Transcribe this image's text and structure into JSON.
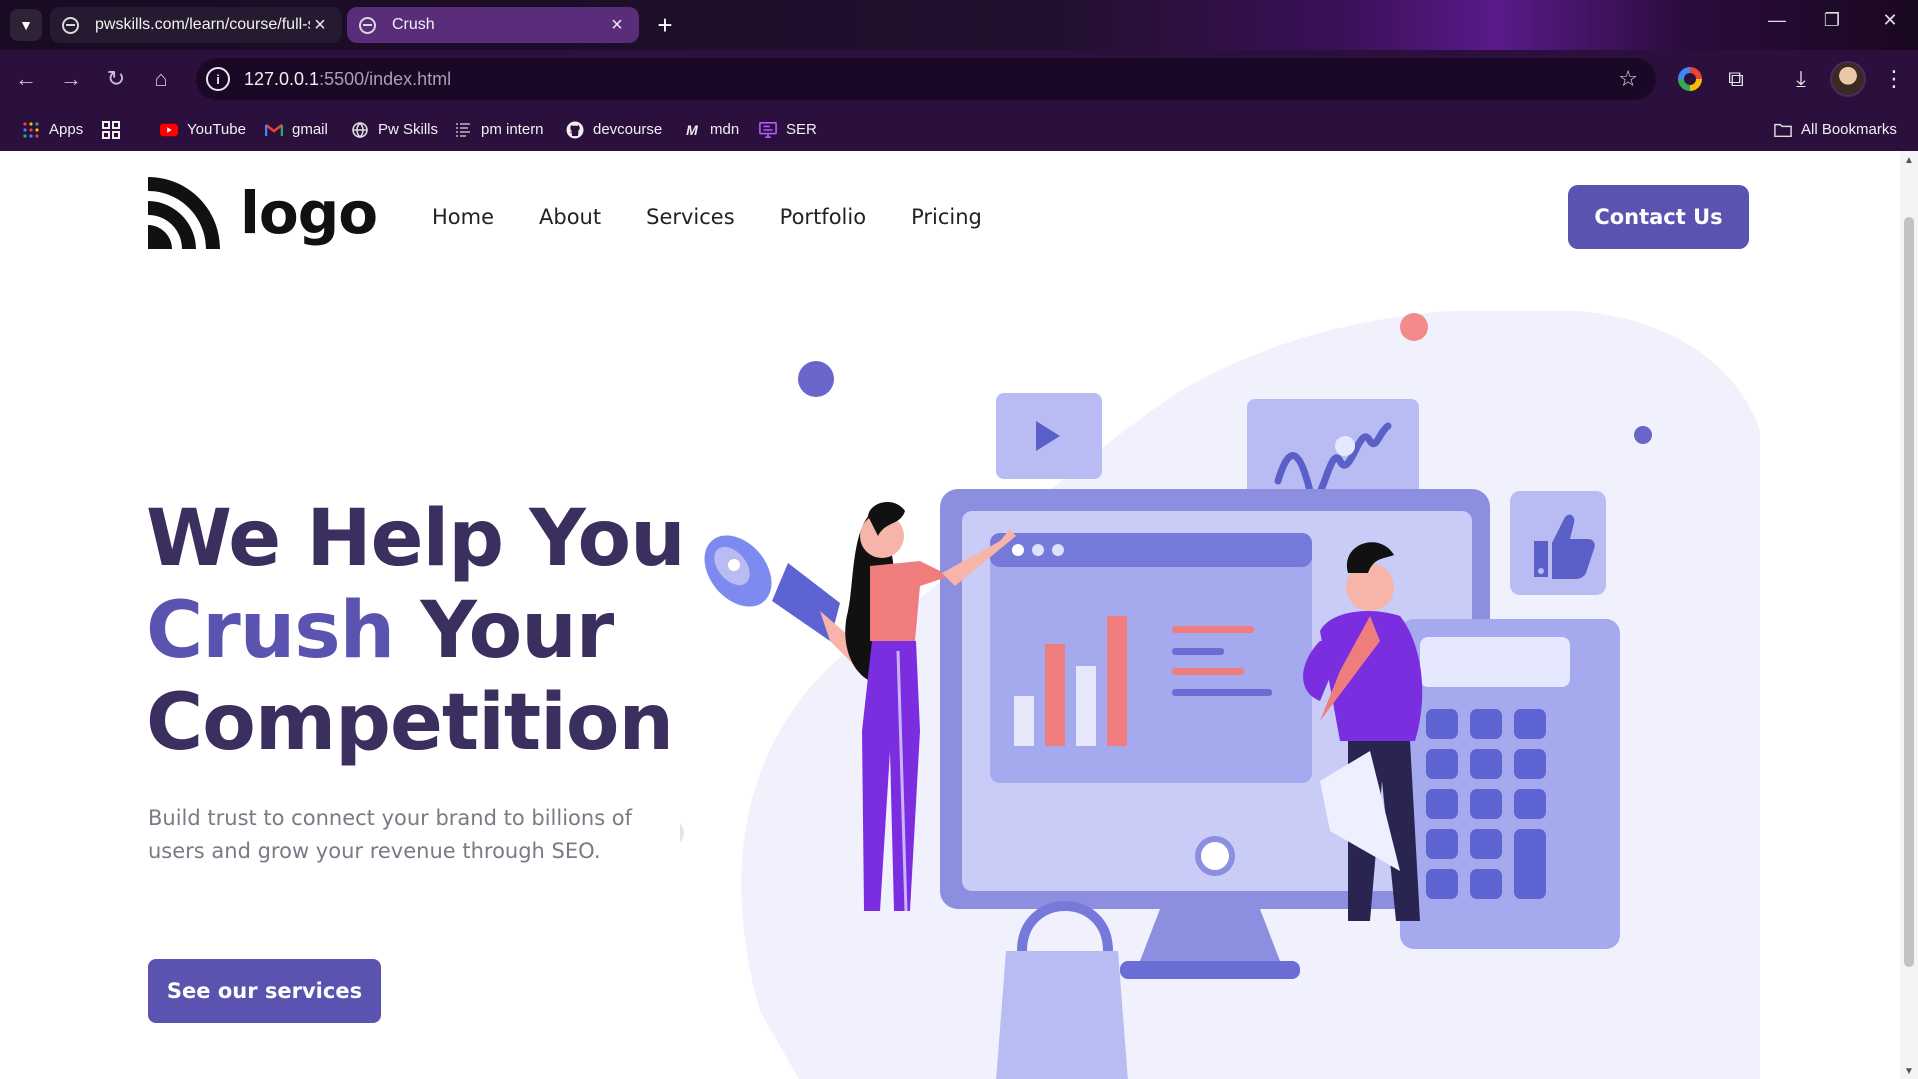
{
  "browser": {
    "tabs": [
      {
        "title": "pwskills.com/learn/course/full-s",
        "active": false
      },
      {
        "title": "Crush",
        "active": true
      }
    ],
    "url": {
      "host": "127.0.0.1",
      "path": ":5500/index.html"
    },
    "bookmarks": [
      {
        "label": "Apps",
        "icon": "apps-grid-icon"
      },
      {
        "label": "",
        "icon": "tab-groups-icon"
      },
      {
        "label": "YouTube",
        "icon": "youtube-icon"
      },
      {
        "label": "gmail",
        "icon": "gmail-icon"
      },
      {
        "label": "Pw Skills",
        "icon": "globe-icon"
      },
      {
        "label": "pm intern",
        "icon": "list-icon"
      },
      {
        "label": "devcourse",
        "icon": "github-icon"
      },
      {
        "label": "mdn",
        "icon": "mdn-icon"
      },
      {
        "label": "SER",
        "icon": "monitor-icon"
      }
    ],
    "all_bookmarks": "All Bookmarks"
  },
  "site": {
    "logo_text": "logo",
    "nav": [
      "Home",
      "About",
      "Services",
      "Portfolio",
      "Pricing"
    ],
    "contact_label": "Contact Us",
    "hero": {
      "line1": "We Help You",
      "accent": "Crush",
      "line2_rest": " Your",
      "line3": "Competition",
      "subtitle": "Build trust to connect your brand to billions of users and grow your revenue through SEO.",
      "cta_label": "See our services"
    },
    "colors": {
      "primary": "#5b53b0",
      "heading": "#3a2f5e",
      "body_text": "#7a7a86"
    }
  }
}
